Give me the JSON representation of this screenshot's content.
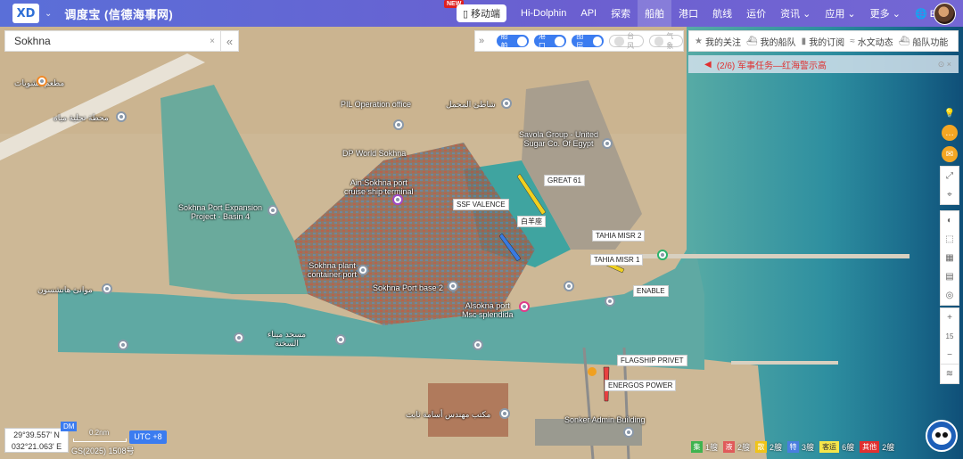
{
  "header": {
    "logo_text": "XD",
    "app_title": "调度宝 (信德海事网)",
    "mobile_label": "移动端",
    "new_badge": "NEW",
    "nav": [
      {
        "label": "Hi-Dolphin",
        "active": false
      },
      {
        "label": "API",
        "active": false
      },
      {
        "label": "探索",
        "active": false
      },
      {
        "label": "船舶",
        "active": true
      },
      {
        "label": "港口",
        "active": false
      },
      {
        "label": "航线",
        "active": false
      },
      {
        "label": "运价",
        "active": false
      },
      {
        "label": "资讯 ⌄",
        "active": false
      },
      {
        "label": "应用 ⌄",
        "active": false
      },
      {
        "label": "更多 ⌄",
        "active": false
      },
      {
        "label": "🌐 EN",
        "active": false
      }
    ]
  },
  "search": {
    "value": "Sokhna",
    "clear_icon": "×",
    "collapse_icon": "«"
  },
  "filters": {
    "collapse_icon": "»",
    "toggles": [
      {
        "label": "船舶",
        "on": true
      },
      {
        "label": "港口",
        "on": true
      },
      {
        "label": "图层",
        "on": true
      },
      {
        "label": "台风",
        "on": false
      },
      {
        "label": "气象",
        "on": false
      }
    ]
  },
  "right_panel": {
    "items": [
      {
        "icon": "star-icon",
        "glyph": "★",
        "label": "我的关注"
      },
      {
        "icon": "ship-icon",
        "glyph": "⛴",
        "label": "我的船队"
      },
      {
        "icon": "bookmark-icon",
        "glyph": "▮",
        "label": "我的订阅"
      },
      {
        "icon": "wave-icon",
        "glyph": "≈",
        "label": "水文动态"
      },
      {
        "icon": "fleet-icon",
        "glyph": "⛴",
        "label": "船队功能"
      }
    ]
  },
  "alert": {
    "text": "(2/6) 军事任务—红海警示高",
    "more": "⊙ ×"
  },
  "map": {
    "labels": [
      {
        "name": "label-pil-operation",
        "text": "PIL Operation office"
      },
      {
        "name": "label-pil-ar",
        "text": "شاطئ المحمل"
      },
      {
        "name": "label-dp-world",
        "text": "DP World Sokhna"
      },
      {
        "name": "label-ain-sokhna",
        "text": "Ain Sokhna port\ncruise ship terminal"
      },
      {
        "name": "label-savola",
        "text": "Savola Group - United\nSugar Co. Of Egypt"
      },
      {
        "name": "label-expansion",
        "text": "Sokhna Port Expansion\nProject - Basin 4"
      },
      {
        "name": "label-plant",
        "text": "Sokhna plant\ncontainer port"
      },
      {
        "name": "label-base2",
        "text": "Sokhna Port base 2"
      },
      {
        "name": "label-alsokna",
        "text": "Alsokna port\nMsc splendida"
      },
      {
        "name": "label-sonker",
        "text": "Sonker Admin Building"
      },
      {
        "name": "label-mosque",
        "text": "مسجد ميناء\nالسخنة"
      },
      {
        "name": "label-ar-1",
        "text": "محطة تحلية مياه"
      },
      {
        "name": "label-ar-2",
        "text": "موانئ هاتشسون"
      },
      {
        "name": "label-ar-3",
        "text": "مكتب مهندس أسامة ثابت"
      },
      {
        "name": "label-ar-4",
        "text": "مطعم مشويات"
      }
    ],
    "ships": [
      {
        "name": "ship-tag-great61",
        "text": "GREAT 61"
      },
      {
        "name": "ship-tag-ssf",
        "text": "SSF VALENCE"
      },
      {
        "name": "ship-tag-baiyang",
        "text": "白羊座"
      },
      {
        "name": "ship-tag-tahia2",
        "text": "TAHIA MISR 2"
      },
      {
        "name": "ship-tag-tahia1",
        "text": "TAHIA MISR 1"
      },
      {
        "name": "ship-tag-enable",
        "text": "ENABLE"
      },
      {
        "name": "ship-tag-flagship",
        "text": "FLAGSHIP PRIVET"
      },
      {
        "name": "ship-tag-energos",
        "text": "ENERGOS POWER"
      }
    ]
  },
  "tools": {
    "zoom_level": "15",
    "zoom_in": "+",
    "zoom_out": "−"
  },
  "bottom": {
    "coord_lat": "29°39.557' N",
    "coord_lon": "032°21.063' E",
    "dm_badge": "DM",
    "scale": "0.2nm",
    "utc": "UTC +8",
    "copyright": "GS(2025) 1508号"
  },
  "legend": [
    {
      "label": "集",
      "count": "1艘",
      "color": "#3fb34f"
    },
    {
      "label": "液",
      "count": "2艘",
      "color": "#e05a5a"
    },
    {
      "label": "散",
      "count": "2艘",
      "color": "#f0c419"
    },
    {
      "label": "特",
      "count": "3艘",
      "color": "#4a7ee0"
    },
    {
      "label": "客运",
      "count": "6艘",
      "color": "#f5e64a"
    },
    {
      "label": "其他",
      "count": "2艘",
      "color": "#e03030"
    }
  ]
}
